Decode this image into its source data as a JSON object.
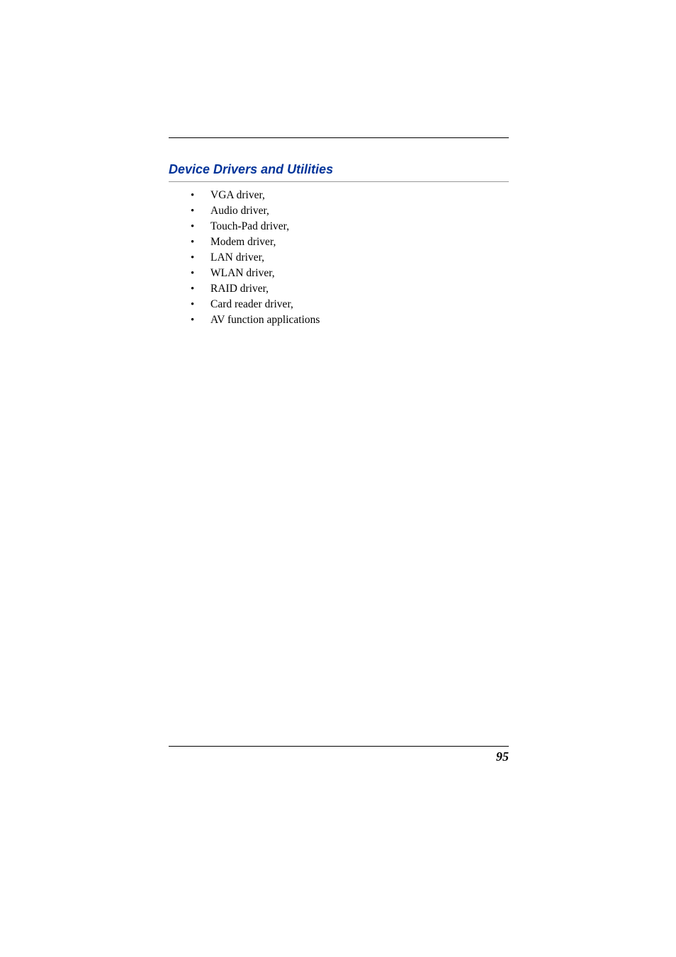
{
  "heading": "Device Drivers and Utilities",
  "drivers": [
    "VGA driver,",
    "Audio driver,",
    "Touch-Pad driver,",
    "Modem driver,",
    "LAN driver,",
    "WLAN driver,",
    "RAID driver,",
    "Card reader driver,",
    "AV function applications"
  ],
  "page_number": "95"
}
